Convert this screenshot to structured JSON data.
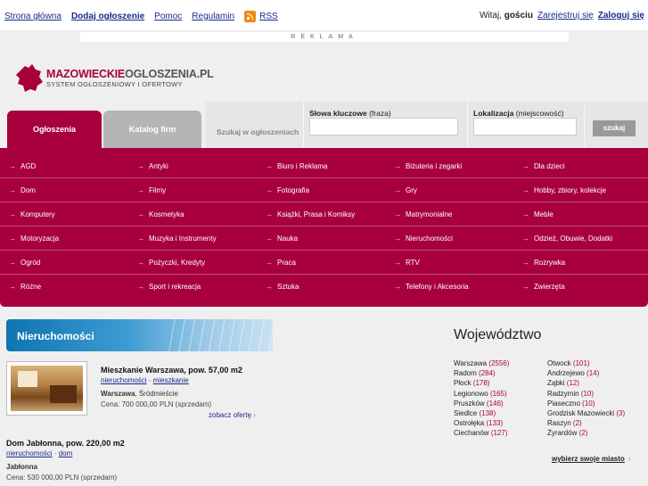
{
  "topnav": {
    "home": "Strona główna",
    "add": "Dodaj ogłoszenie",
    "help": "Pomoc",
    "rules": "Regulamin",
    "rss": "RSS"
  },
  "user": {
    "greeting": "Witaj,",
    "guest": "gościu",
    "register": "Zarejestruj się",
    "login": "Zaloguj się"
  },
  "ad": {
    "label": "REKLAMA"
  },
  "logo": {
    "title_a": "MAZOWIECKIE",
    "title_b": "OGLOSZENIA.PL",
    "subtitle": "SYSTEM OGŁOSZENIOWY I OFERTOWY",
    "brand_color": "#a8003d"
  },
  "tabs": {
    "ads": "Ogłoszenia",
    "firms": "Katalog firm"
  },
  "search": {
    "scope_label": "Szukaj w ogłoszeniach",
    "keywords_label": "Słowa kluczowe",
    "keywords_hint": "(fraza)",
    "location_label": "Lokalizacja",
    "location_hint": "(miejscowość)",
    "button": "szukaj"
  },
  "categories": [
    [
      "AGD",
      "Antyki",
      "Biuro i Reklama",
      "Biżuteria i zegarki",
      "Dla dzieci"
    ],
    [
      "Dom",
      "Filmy",
      "Fotografia",
      "Gry",
      "Hobby, zbiory, kolekcje"
    ],
    [
      "Komputery",
      "Kosmetyka",
      "Książki, Prasa i Komiksy",
      "Matrymonialne",
      "Meble"
    ],
    [
      "Motoryzacja",
      "Muzyka i Instrumenty",
      "Nauka",
      "Nieruchomości",
      "Odzież, Obuwie, Dodatki"
    ],
    [
      "Ogród",
      "Pożyczki, Kredyty",
      "Praca",
      "RTV",
      "Rozrywka"
    ],
    [
      "Różne",
      "Sport i rekreacja",
      "Sztuka",
      "Telefony i Akcesoria",
      "Zwierzęta"
    ]
  ],
  "banner": {
    "title": "Nieruchomości"
  },
  "listings": [
    {
      "title": "Mieszkanie Warszawa, pow. 57,00 m2",
      "tag1": "nieruchomości",
      "tag2": "mieszkanie",
      "city": "Warszawa",
      "district": ", Śródmieście",
      "price": "Cena: 700 000,00 PLN (sprzedam)",
      "more": "zobacz ofertę"
    },
    {
      "title": "Dom Jabłonna, pow. 220,00 m2",
      "tag1": "nieruchomości",
      "tag2": "dom",
      "city": "Jabłonna",
      "price": "Cena: 530 000,00 PLN (sprzedam)"
    }
  ],
  "wojewodztwo": {
    "title": "Województwo",
    "col1": [
      {
        "name": "Warszawa",
        "count": "(2556)"
      },
      {
        "name": "Radom",
        "count": "(284)"
      },
      {
        "name": "Płock",
        "count": "(178)"
      },
      {
        "name": "Legionowo",
        "count": "(165)"
      },
      {
        "name": "Pruszków",
        "count": "(146)"
      },
      {
        "name": "Siedlce",
        "count": "(138)"
      },
      {
        "name": "Ostrołęka",
        "count": "(133)"
      },
      {
        "name": "Ciechanów",
        "count": "(127)"
      }
    ],
    "col2": [
      {
        "name": "Otwock",
        "count": "(101)"
      },
      {
        "name": "Andrzejewo",
        "count": "(14)"
      },
      {
        "name": "Ząbki",
        "count": "(12)"
      },
      {
        "name": "Radzymin",
        "count": "(10)"
      },
      {
        "name": "Piaseczno",
        "count": "(10)"
      },
      {
        "name": "Grodzisk Mazowiecki",
        "count": "(3)"
      },
      {
        "name": "Raszyn",
        "count": "(2)"
      },
      {
        "name": "Żyrardów",
        "count": "(2)"
      }
    ],
    "choose": "wybierz swoje miasto"
  }
}
